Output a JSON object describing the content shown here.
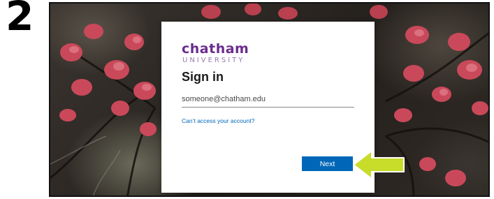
{
  "step": {
    "number": "2"
  },
  "brand": {
    "name": "chatham",
    "subtitle": "UNIVERSITY",
    "color": "#6b2c8e"
  },
  "signin": {
    "title": "Sign in",
    "email_placeholder": "someone@chatham.edu",
    "help_link": "Can’t access your account?",
    "next_label": "Next",
    "accent_color": "#0067b8"
  },
  "annotation": {
    "icon": "arrow-left-icon",
    "color": "#c8dc2a"
  }
}
